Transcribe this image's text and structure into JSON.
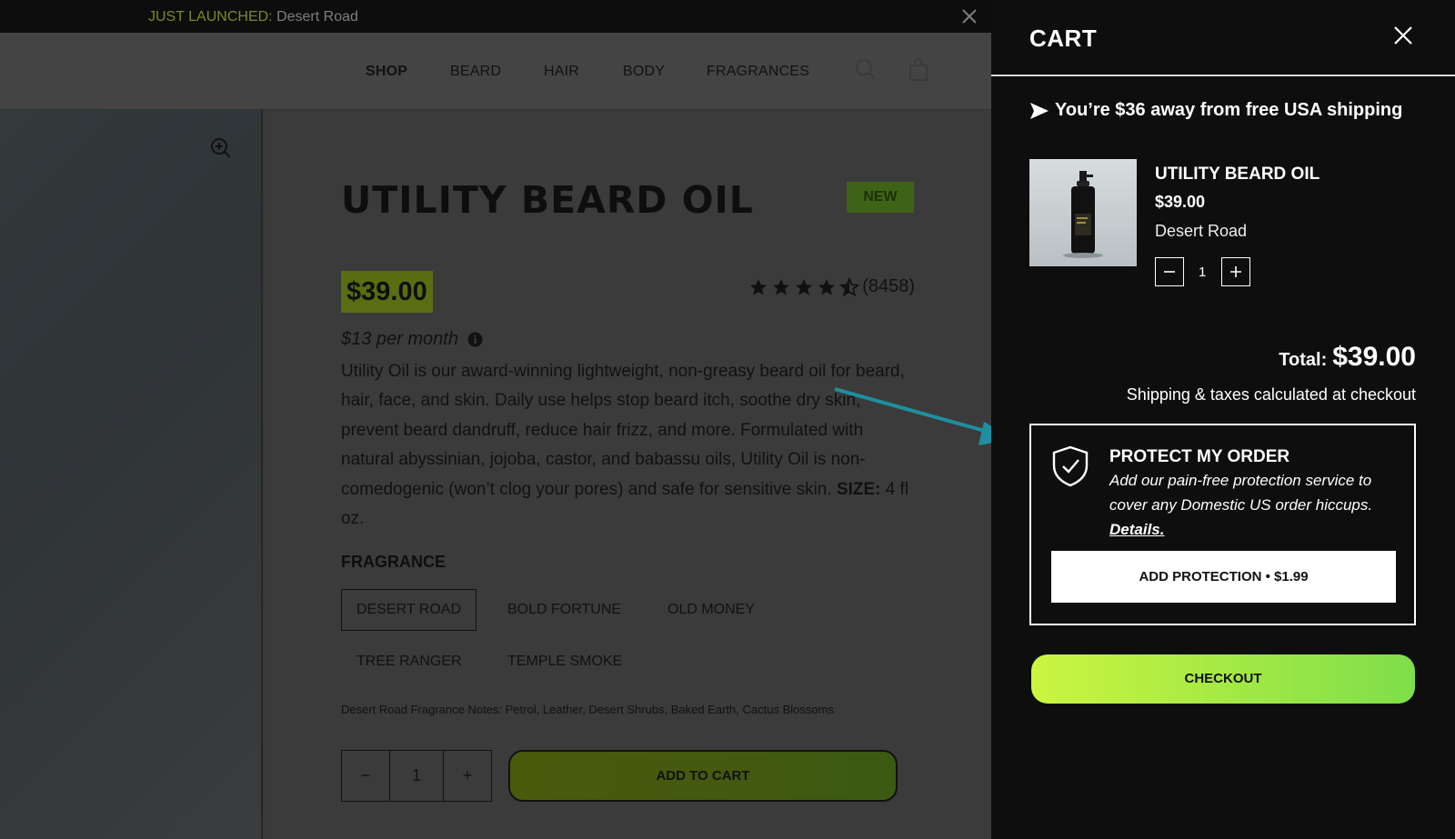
{
  "announcement": {
    "prefix": "JUST LAUNCHED:",
    "text": " Desert Road"
  },
  "nav": {
    "items": [
      "SHOP",
      "BEARD",
      "HAIR",
      "BODY",
      "FRAGRANCES"
    ],
    "icons": [
      "search-icon",
      "cart-icon"
    ]
  },
  "product": {
    "title": "UTILITY BEARD OIL",
    "badge": "NEW",
    "price": "$39.00",
    "rating_count": "(8458)",
    "rating_value": 4.5,
    "per_month": "$13 per month",
    "description": "Utility Oil is our award-winning lightweight, non-greasy beard oil for beard, hair, face, and skin. Daily use helps stop beard itch, soothe dry skin, prevent beard dandruff, reduce hair frizz, and more. Formulated with natural abyssinian, jojoba, castor, and babassu oils, Utility Oil is non-comedogenic (won’t clog your pores) and safe for sensitive skin. ",
    "size_label": "SIZE:",
    "size_value": " 4 fl oz.",
    "fragrance_label": "FRAGRANCE",
    "fragrances": [
      "DESERT ROAD",
      "BOLD FORTUNE",
      "OLD MONEY",
      "TREE RANGER",
      "TEMPLE SMOKE"
    ],
    "selected_fragrance": "DESERT ROAD",
    "fragrance_notes": "Desert Road Fragrance Notes: Petrol, Leather, Desert Shrubs, Baked Earth, Cactus Blossoms",
    "quantity": "1",
    "qty_minus": "−",
    "qty_plus": "+",
    "add_to_cart": "ADD TO CART"
  },
  "cart": {
    "title": "CART",
    "shipping_message": "You’re $36 away from free USA shipping",
    "item": {
      "name": "UTILITY BEARD OIL",
      "price": "$39.00",
      "variant": "Desert Road",
      "quantity": "1"
    },
    "total_label": "Total:",
    "total_value": "$39.00",
    "shipping_note": "Shipping & taxes calculated at checkout",
    "protection": {
      "title": "PROTECT MY ORDER",
      "body": "Add our pain-free protection service to cover any Domestic US order hiccups. ",
      "details_link": "Details.",
      "button": "ADD PROTECTION • $1.99"
    },
    "checkout": "CHECKOUT"
  },
  "colors": {
    "accent_green": "#ccf540",
    "annotation_arrow": "#1f8fa0",
    "cart_bg": "#0e0e0e"
  }
}
